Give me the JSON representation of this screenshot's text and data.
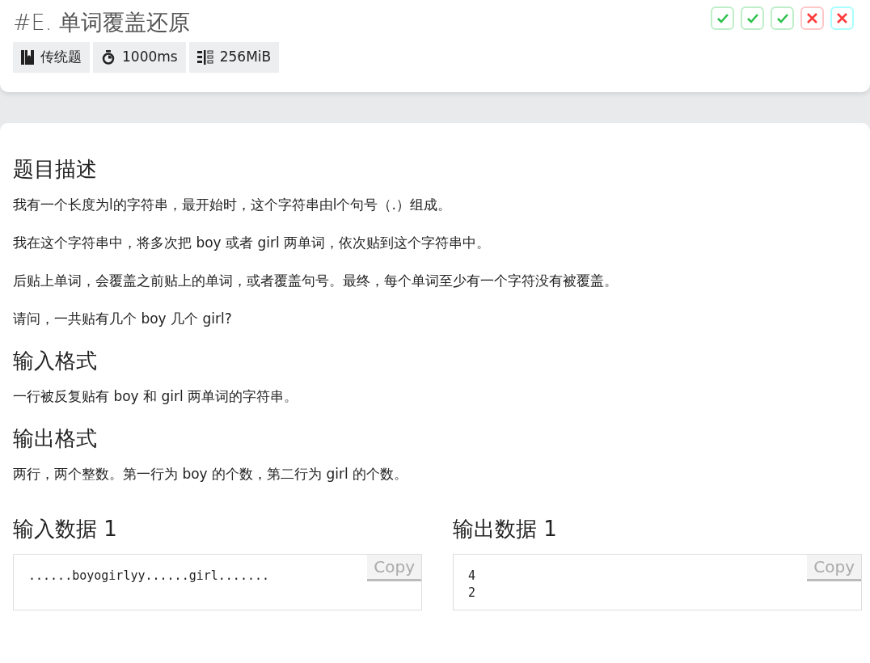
{
  "problem": {
    "title": "#E. 单词覆盖还原",
    "tags": [
      {
        "kind": "type",
        "label": "传统题"
      },
      {
        "kind": "time",
        "label": "1000ms"
      },
      {
        "kind": "memory",
        "label": "256MiB"
      }
    ]
  },
  "results": [
    {
      "kind": "pass",
      "color": "#bfeec9"
    },
    {
      "kind": "pass",
      "color": "#bfeec9"
    },
    {
      "kind": "pass",
      "color": "#bfeec9"
    },
    {
      "kind": "fail",
      "color": "#ffc8c8"
    },
    {
      "kind": "fail",
      "color": "#aaffff"
    }
  ],
  "sections": [
    {
      "heading": "题目描述",
      "paragraphs": [
        "我有一个长度为l的字符串，最开始时，这个字符串由l个句号（.）组成。",
        "我在这个字符串中，将多次把 boy 或者 girl 两单词，依次贴到这个字符串中。",
        "后贴上单词，会覆盖之前贴上的单词，或者覆盖句号。最终，每个单词至少有一个字符没有被覆盖。",
        "请问，一共贴有几个 boy 几个 girl?"
      ]
    },
    {
      "heading": "输入格式",
      "paragraphs": [
        "一行被反复贴有 boy 和 girl 两单词的字符串。"
      ]
    },
    {
      "heading": "输出格式",
      "paragraphs": [
        "两行，两个整数。第一行为 boy 的个数，第二行为 girl 的个数。"
      ]
    }
  ],
  "samples": [
    {
      "heading": "输入数据 1",
      "copy": "Copy",
      "lines": [
        "......boyogirlyy......girl......."
      ]
    },
    {
      "heading": "输出数据 1",
      "copy": "Copy",
      "lines": [
        "4",
        "2"
      ]
    }
  ]
}
